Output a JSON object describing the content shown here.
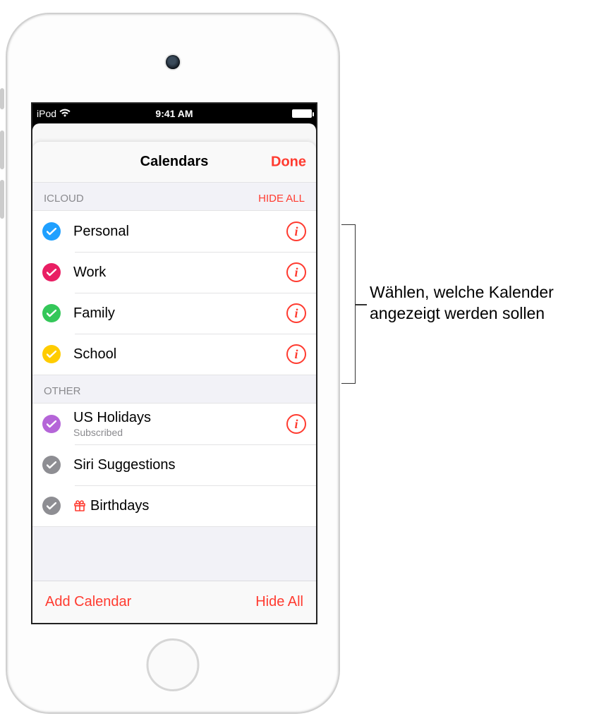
{
  "status_bar": {
    "carrier": "iPod",
    "time": "9:41 AM"
  },
  "sheet": {
    "title": "Calendars",
    "done": "Done"
  },
  "sections": {
    "icloud": {
      "title": "ICLOUD",
      "action": "HIDE ALL",
      "items": [
        {
          "label": "Personal",
          "color": "#1fa0ff"
        },
        {
          "label": "Work",
          "color": "#e91e63"
        },
        {
          "label": "Family",
          "color": "#34c759"
        },
        {
          "label": "School",
          "color": "#ffcc00"
        }
      ]
    },
    "other": {
      "title": "OTHER",
      "items": [
        {
          "label": "US Holidays",
          "sub": "Subscribed",
          "color": "#b565d8",
          "info": true
        },
        {
          "label": "Siri Suggestions",
          "color": "#8e8e93",
          "info": false
        },
        {
          "label": "Birthdays",
          "color": "#8e8e93",
          "info": false,
          "icon": "gift"
        }
      ]
    }
  },
  "toolbar": {
    "add": "Add Calendar",
    "hide_all": "Hide All"
  },
  "callout": {
    "line1": "Wählen, welche Kalender",
    "line2": "angezeigt werden sollen"
  }
}
